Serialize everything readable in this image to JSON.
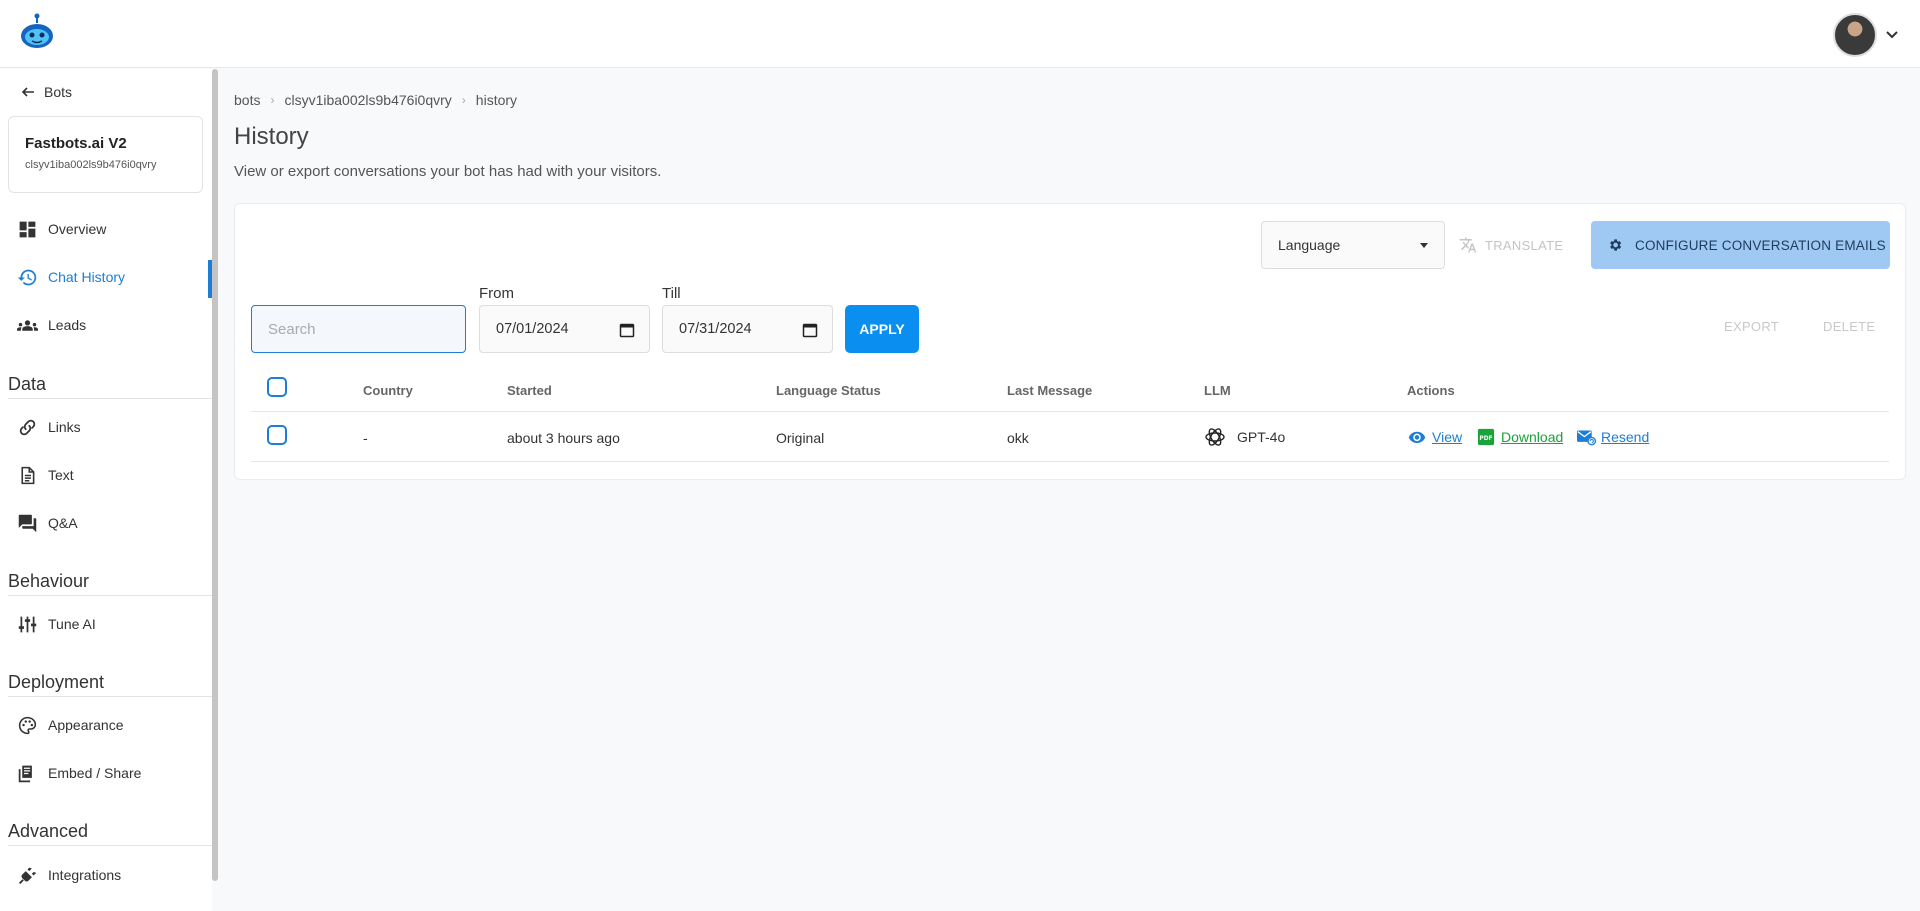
{
  "header": {
    "logo_icon": "robot-logo-icon",
    "avatar_icon": "user-avatar",
    "menu_icon": "chevron-down-icon"
  },
  "sidebar": {
    "back_label": "Bots",
    "bot": {
      "name": "Fastbots.ai V2",
      "id": "clsyv1iba002ls9b476i0qvry"
    },
    "items": [
      {
        "label": "Overview",
        "icon": "dashboard-icon"
      },
      {
        "label": "Chat History",
        "icon": "history-icon",
        "active": true
      },
      {
        "label": "Leads",
        "icon": "people-icon"
      }
    ],
    "sections": [
      {
        "title": "Data",
        "items": [
          {
            "label": "Links",
            "icon": "link-icon"
          },
          {
            "label": "Text",
            "icon": "document-icon"
          },
          {
            "label": "Q&A",
            "icon": "forum-icon"
          }
        ]
      },
      {
        "title": "Behaviour",
        "items": [
          {
            "label": "Tune AI",
            "icon": "sliders-icon"
          }
        ]
      },
      {
        "title": "Deployment",
        "items": [
          {
            "label": "Appearance",
            "icon": "palette-icon"
          },
          {
            "label": "Embed / Share",
            "icon": "embed-icon"
          }
        ]
      },
      {
        "title": "Advanced",
        "items": [
          {
            "label": "Integrations",
            "icon": "plug-icon"
          }
        ]
      }
    ]
  },
  "breadcrumb": [
    "bots",
    "clsyv1iba002ls9b476i0qvry",
    "history"
  ],
  "page": {
    "title": "History",
    "subtitle": "View or export conversations your bot has had with your visitors."
  },
  "toolbar": {
    "language_label": "Language",
    "translate_label": "TRANSLATE",
    "configure_label": "CONFIGURE CONVERSATION EMAILS"
  },
  "filters": {
    "search_placeholder": "Search",
    "from_label": "From",
    "from_value": "07/01/2024",
    "till_label": "Till",
    "till_value": "07/31/2024",
    "apply_label": "APPLY",
    "export_label": "EXPORT",
    "delete_label": "DELETE"
  },
  "table": {
    "columns": [
      "Country",
      "Started",
      "Language Status",
      "Last Message",
      "LLM",
      "Actions"
    ],
    "rows": [
      {
        "country": "-",
        "started": "about 3 hours ago",
        "language_status": "Original",
        "last_message": "okk",
        "llm": "GPT-4o",
        "actions": {
          "view": "View",
          "download": "Download",
          "resend": "Resend"
        }
      }
    ]
  },
  "colors": {
    "accent": "#1c7ed6",
    "apply": "#0a8ff0",
    "configure": "#9fc8f3",
    "download": "#1aa33a"
  }
}
